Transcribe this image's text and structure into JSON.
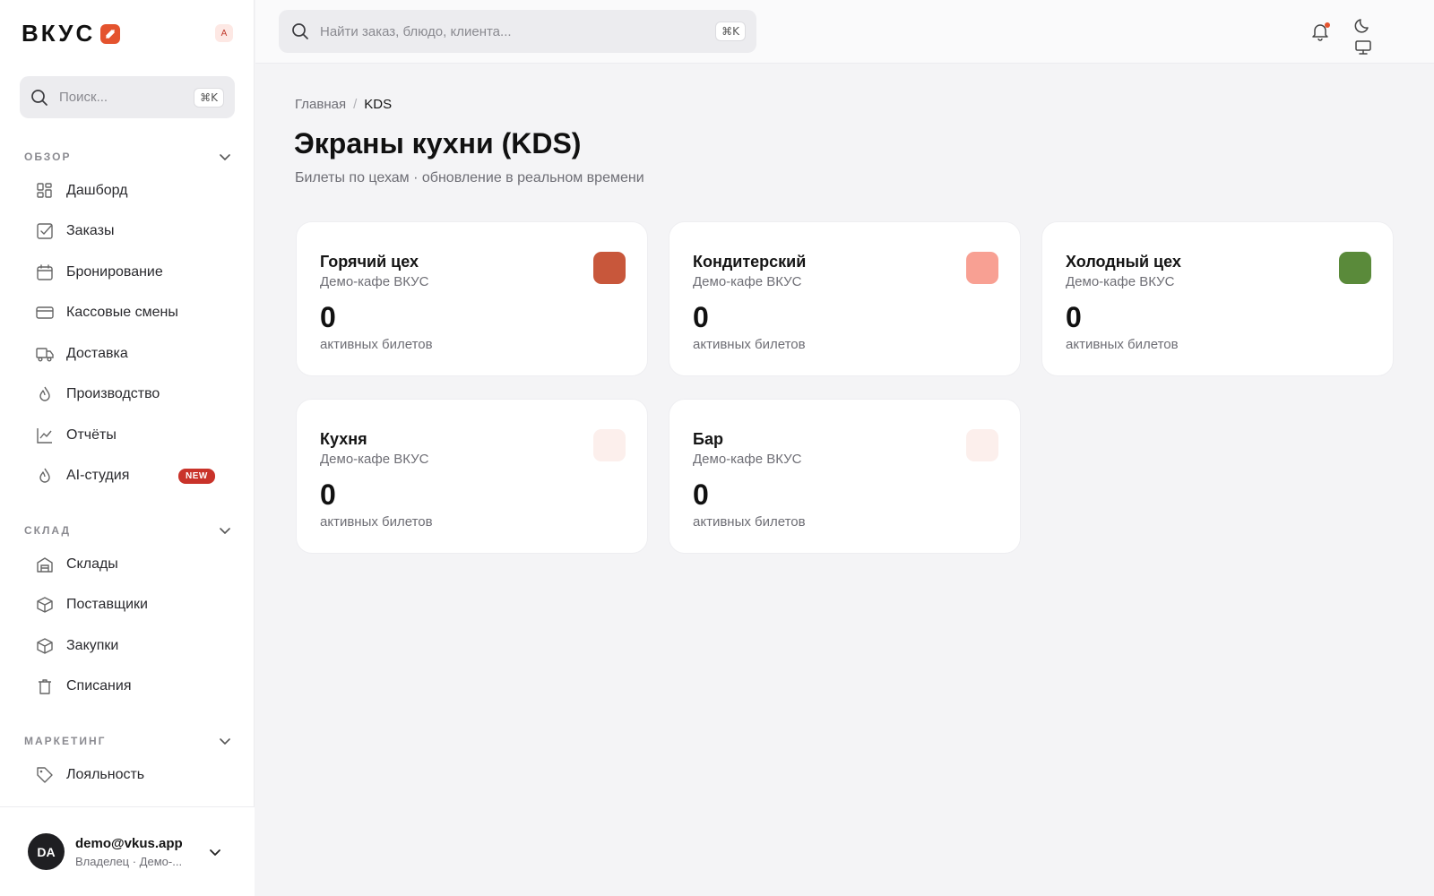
{
  "brand": {
    "name": "ВКУС",
    "user_chip": "A"
  },
  "sidebar": {
    "search_placeholder": "Поиск...",
    "search_shortcut": "⌘K",
    "sections": [
      {
        "title": "ОБЗОР",
        "items": [
          {
            "label": "Дашборд",
            "icon": "dashboard-icon"
          },
          {
            "label": "Заказы",
            "icon": "checkbox-icon"
          },
          {
            "label": "Бронирование",
            "icon": "calendar-icon"
          },
          {
            "label": "Кассовые смены",
            "icon": "credit-card-icon"
          },
          {
            "label": "Доставка",
            "icon": "truck-icon"
          },
          {
            "label": "Производство",
            "icon": "flame-icon"
          },
          {
            "label": "Отчёты",
            "icon": "chart-icon"
          },
          {
            "label": "AI-студия",
            "icon": "flame-icon",
            "badge": "NEW"
          }
        ]
      },
      {
        "title": "СКЛАД",
        "items": [
          {
            "label": "Склады",
            "icon": "warehouse-icon"
          },
          {
            "label": "Поставщики",
            "icon": "box-icon"
          },
          {
            "label": "Закупки",
            "icon": "box-icon"
          },
          {
            "label": "Списания",
            "icon": "trash-icon"
          }
        ]
      },
      {
        "title": "МАРКЕТИНГ",
        "items": [
          {
            "label": "Лояльность",
            "icon": "tag-icon"
          }
        ]
      }
    ],
    "footer": {
      "avatar": "DA",
      "email": "demo@vkus.app",
      "role": "Владелец · Демо-..."
    }
  },
  "topbar": {
    "search_placeholder": "Найти заказ, блюдо, клиента...",
    "search_shortcut": "⌘K"
  },
  "breadcrumb": {
    "home": "Главная",
    "separator": "/",
    "current": "KDS"
  },
  "page": {
    "title": "Экраны кухни (KDS)",
    "subtitle": "Билеты по цехам · обновление в реальном времени"
  },
  "stations": [
    {
      "name": "Горячий цех",
      "venue": "Демо-кафе ВКУС",
      "count": "0",
      "unit": "активных билетов",
      "color": "#c8573b"
    },
    {
      "name": "Кондитерский",
      "venue": "Демо-кафе ВКУС",
      "count": "0",
      "unit": "активных билетов",
      "color": "#f8a093"
    },
    {
      "name": "Холодный цех",
      "venue": "Демо-кафе ВКУС",
      "count": "0",
      "unit": "активных билетов",
      "color": "#5a8a3a"
    },
    {
      "name": "Кухня",
      "venue": "Демо-кафе ВКУС",
      "count": "0",
      "unit": "активных билетов",
      "color": "#fcefec"
    },
    {
      "name": "Бар",
      "venue": "Демо-кафе ВКУС",
      "count": "0",
      "unit": "активных билетов",
      "color": "#fcefec"
    }
  ]
}
